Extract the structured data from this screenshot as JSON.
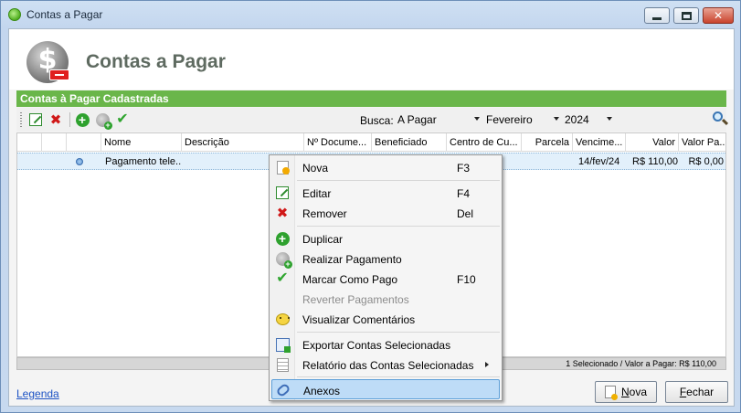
{
  "window": {
    "title": "Contas a Pagar"
  },
  "header": {
    "title": "Contas a Pagar"
  },
  "panel": {
    "title": "Contas à Pagar Cadastradas"
  },
  "toolbar": {
    "search_label": "Busca:",
    "filters": {
      "status": "A Pagar",
      "month": "Fevereiro",
      "year": "2024"
    }
  },
  "grid": {
    "columns": [
      "Nome",
      "Descrição",
      "Nº Docume...",
      "Beneficiado",
      "Centro de Cu...",
      "Parcela",
      "Vencime...",
      "Valor",
      "Valor Pa..."
    ],
    "rows": [
      {
        "nome": "Pagamento tele...",
        "vencimento": "14/fev/24",
        "valor": "R$ 110,00",
        "valor_pago": "R$ 0,00"
      }
    ]
  },
  "status": {
    "text": "1 Selecionado / Valor a Pagar: R$ 110,00"
  },
  "footer": {
    "legend_link": "Legenda",
    "nova_label": "Nova",
    "fechar_label": "Fechar"
  },
  "context_menu": {
    "items": [
      {
        "label": "Nova",
        "shortcut": "F3",
        "icon": "new-document-icon"
      },
      {
        "label": "Editar",
        "shortcut": "F4",
        "icon": "edit-icon"
      },
      {
        "label": "Remover",
        "shortcut": "Del",
        "icon": "delete-icon"
      },
      {
        "label": "Duplicar",
        "shortcut": "",
        "icon": "add-icon"
      },
      {
        "label": "Realizar Pagamento",
        "shortcut": "",
        "icon": "payment-icon"
      },
      {
        "label": "Marcar Como Pago",
        "shortcut": "F10",
        "icon": "checkmark-icon"
      },
      {
        "label": "Reverter Pagamentos",
        "shortcut": "",
        "icon": "",
        "disabled": true
      },
      {
        "label": "Visualizar Comentários",
        "shortcut": "",
        "icon": "comment-icon"
      },
      {
        "label": "Exportar Contas Selecionadas",
        "shortcut": "",
        "icon": "export-icon"
      },
      {
        "label": "Relatório das Contas Selecionadas",
        "shortcut": "",
        "icon": "report-icon",
        "submenu": true
      },
      {
        "label": "Anexos",
        "shortcut": "",
        "icon": "attachment-icon",
        "highlighted": true
      }
    ]
  }
}
